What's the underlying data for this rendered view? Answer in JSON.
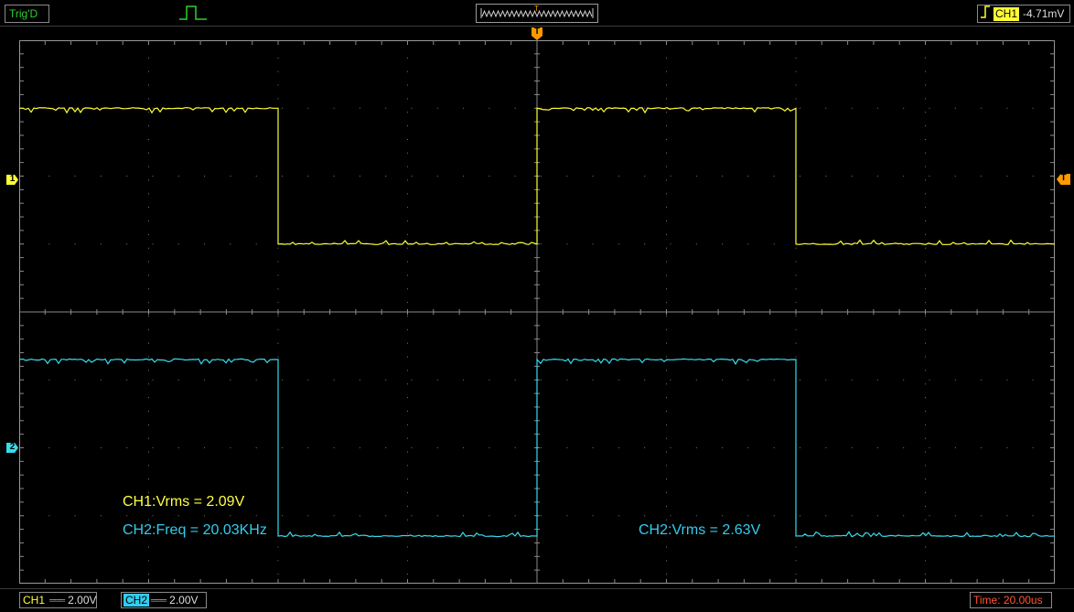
{
  "header": {
    "trigger_status": "Trig'D",
    "overview_trigger_label": "T",
    "trigger_channel": "CH1",
    "trigger_level": "-4.71mV",
    "trigger_edge_icon": "rising-edge-icon"
  },
  "markers": {
    "ch1": "1",
    "ch2": "2",
    "trigger_position": "T",
    "trigger_level": "T"
  },
  "measurements": {
    "ch1_vrms": "CH1:Vrms = 2.09V",
    "ch2_freq": "CH2:Freq = 20.03KHz",
    "ch2_vrms": "CH2:Vrms = 2.63V"
  },
  "footer": {
    "ch1_label": "CH1",
    "ch1_scale": "2.00V",
    "ch2_label": "CH2",
    "ch2_scale": "2.00V",
    "timebase": "Time: 20.00us"
  },
  "colors": {
    "ch1": "#ffff33",
    "ch2": "#33ddee",
    "trigger": "#ff9900",
    "status_ok": "#2fd02f",
    "timebase": "#ff5533"
  },
  "chart_data": {
    "type": "line",
    "title": "",
    "xlabel": "",
    "ylabel": "",
    "x_divisions": 8,
    "y_divisions": 8,
    "time_per_div_us": 20,
    "volts_per_div": 2,
    "grid": true,
    "series": [
      {
        "name": "CH1",
        "offset_div": 2,
        "period_div": 4,
        "phase_div": 0,
        "high_div": 1,
        "low_div": -1,
        "points_div": [
          [
            0,
            1
          ],
          [
            2,
            1
          ],
          [
            2,
            -1
          ],
          [
            4,
            -1
          ],
          [
            4,
            1
          ],
          [
            6,
            1
          ],
          [
            6,
            -1
          ],
          [
            8,
            -1
          ]
        ]
      },
      {
        "name": "CH2",
        "offset_div": -2,
        "period_div": 4,
        "phase_div": 0,
        "high_div": 1.3,
        "low_div": -1.3,
        "points_div": [
          [
            0,
            1.3
          ],
          [
            2,
            1.3
          ],
          [
            2,
            -1.3
          ],
          [
            4,
            -1.3
          ],
          [
            4,
            1.3
          ],
          [
            6,
            1.3
          ],
          [
            6,
            -1.3
          ],
          [
            8,
            -1.3
          ]
        ]
      }
    ]
  }
}
